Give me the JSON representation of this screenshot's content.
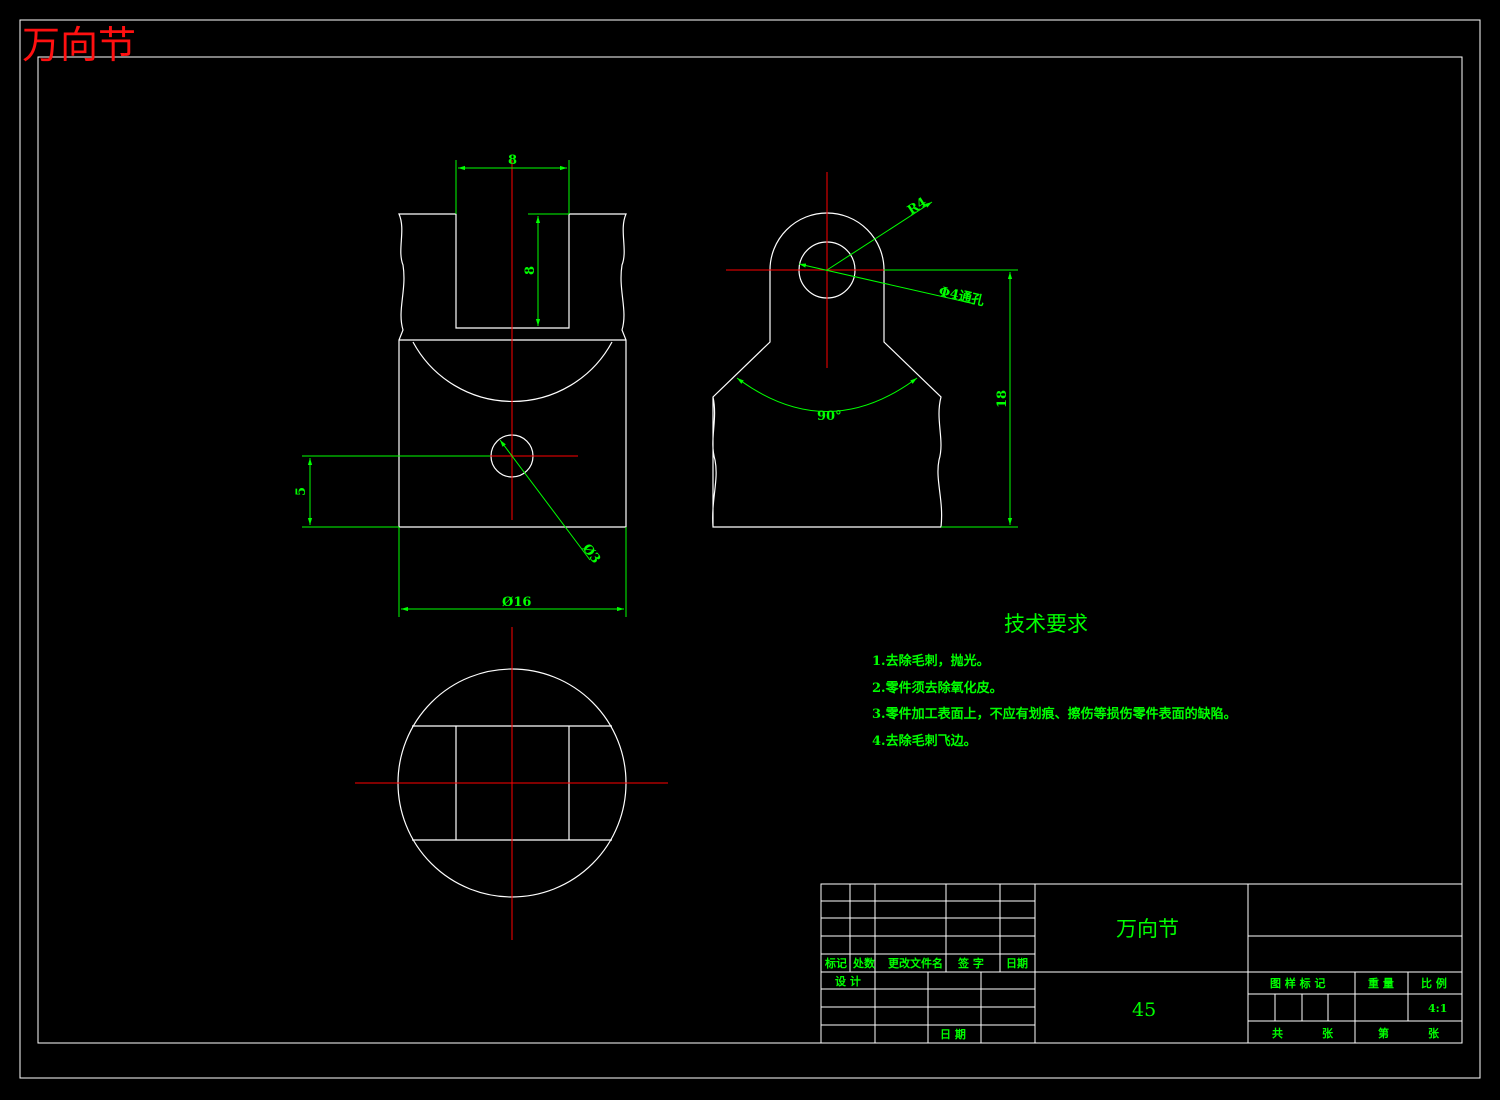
{
  "corner_title": "万向节",
  "dimensions": {
    "slot_width": "8",
    "slot_depth": "8",
    "hole_offset": "5",
    "hole_dia": "Ø3",
    "outer_dia": "Ø16",
    "radius": "R4",
    "through_hole": "Φ4通孔",
    "angle": "90°",
    "height": "18"
  },
  "tech_requirements": {
    "heading": "技术要求",
    "items": [
      "1.去除毛刺，抛光。",
      "2.零件须去除氧化皮。",
      "3.零件加工表面上，不应有划痕、擦伤等损伤零件表面的缺陷。",
      "4.去除毛刺飞边。"
    ]
  },
  "title_block": {
    "part_name": "万向节",
    "material": "45",
    "headers": {
      "mark": "标记",
      "count": "处数",
      "change_doc": "更改文件名",
      "signature": "签 字",
      "date": "日期",
      "design": "设 计",
      "date2": "日 期",
      "stage_mark": "图 样 标 记",
      "weight": "重 量",
      "scale": "比 例",
      "total": "共",
      "sheets": "张",
      "page": "第",
      "sheet": "张"
    },
    "scale_value": "4:1"
  },
  "colors": {
    "outline": "#ffffff",
    "centerline": "#ff0000",
    "dimension": "#00ff00",
    "corner_title": "#ff1010"
  }
}
